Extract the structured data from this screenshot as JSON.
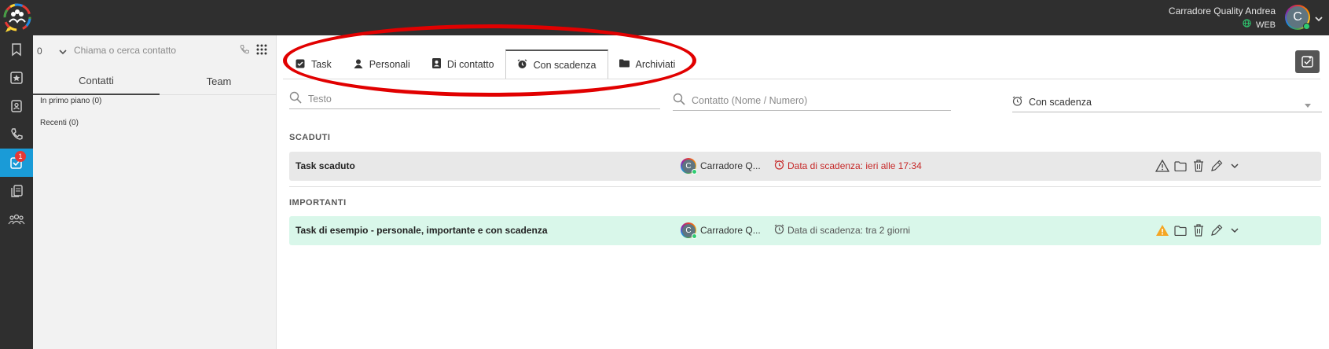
{
  "user": {
    "name": "Carradore Quality Andrea",
    "status": "WEB",
    "initial": "C"
  },
  "rail": {
    "tasks_badge": "1"
  },
  "contacts": {
    "count": "0",
    "search_placeholder": "Chiama o cerca contatto",
    "tabs": [
      {
        "label": "Contatti"
      },
      {
        "label": "Team"
      }
    ],
    "groups": [
      {
        "label": "In primo piano (0)"
      },
      {
        "label": "Recenti (0)"
      }
    ]
  },
  "tabs": [
    {
      "label": "Task"
    },
    {
      "label": "Personali"
    },
    {
      "label": "Di contatto"
    },
    {
      "label": "Con scadenza"
    },
    {
      "label": "Archiviati"
    }
  ],
  "filters": {
    "text_placeholder": "Testo",
    "contact_placeholder": "Contatto (Nome / Numero)",
    "type_value": "Con scadenza"
  },
  "sections": [
    {
      "label": "SCADUTI",
      "tasks": [
        {
          "title": "Task scaduto",
          "owner": "Carradore Q...",
          "owner_initial": "C",
          "due": "Data di scadenza: ieri alle 17:34",
          "status_color": "#c62828"
        }
      ]
    },
    {
      "label": "IMPORTANTI",
      "tasks": [
        {
          "title": "Task di esempio - personale, importante e con scadenza",
          "owner": "Carradore Q...",
          "owner_initial": "C",
          "due": "Data di scadenza: tra 2 giorni",
          "important_color": "#f5a623"
        }
      ]
    }
  ],
  "colors": {
    "accent": "#1a9bd7",
    "topbar": "#2f2f2f",
    "annotation": "#e10000"
  }
}
